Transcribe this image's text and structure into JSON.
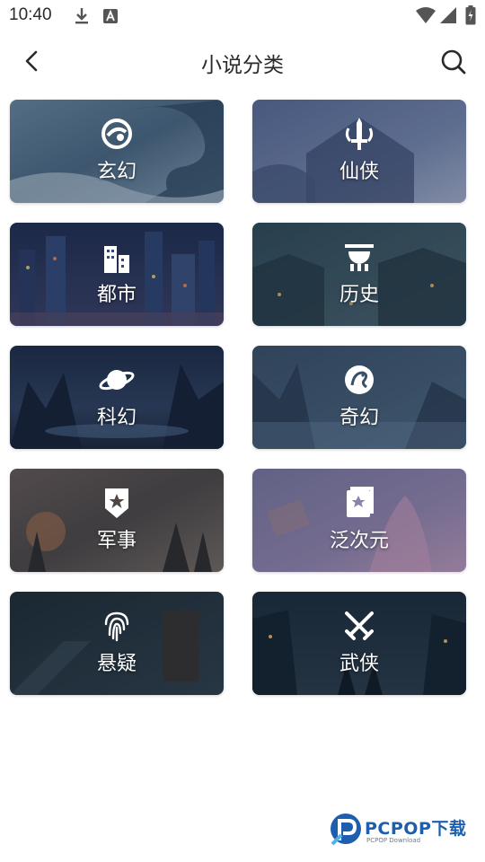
{
  "status_bar": {
    "time": "10:40"
  },
  "header": {
    "title": "小说分类"
  },
  "categories": [
    {
      "label": "玄幻",
      "icon": "dragon-swirl-icon"
    },
    {
      "label": "仙侠",
      "icon": "sword-icon"
    },
    {
      "label": "都市",
      "icon": "city-buildings-icon"
    },
    {
      "label": "历史",
      "icon": "ancient-vessel-icon"
    },
    {
      "label": "科幻",
      "icon": "planet-icon"
    },
    {
      "label": "奇幻",
      "icon": "dragon-icon"
    },
    {
      "label": "军事",
      "icon": "military-badge-icon"
    },
    {
      "label": "泛次元",
      "icon": "book-star-icon"
    },
    {
      "label": "悬疑",
      "icon": "fingerprint-icon"
    },
    {
      "label": "武侠",
      "icon": "crossed-swords-icon"
    }
  ],
  "watermark": {
    "brand": "PCPOP下载",
    "sub": "PCPOP Download"
  }
}
